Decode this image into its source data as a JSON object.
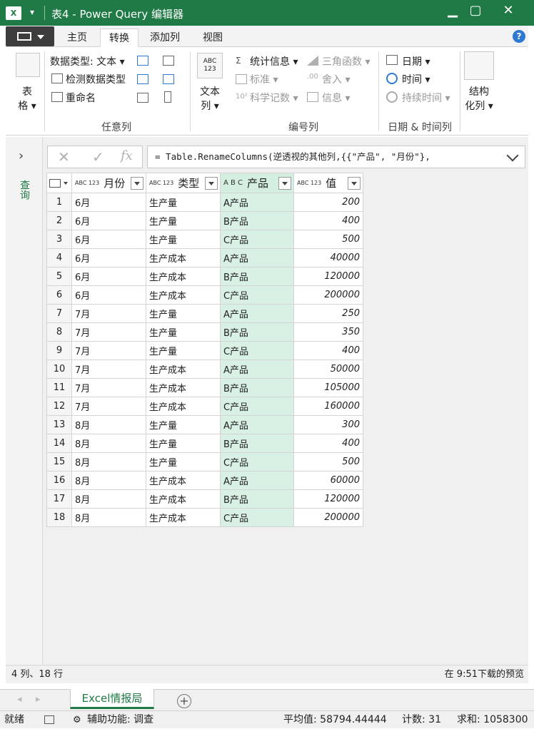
{
  "window": {
    "title": "表4 - Power Query 编辑器",
    "app_badge": "X",
    "quick_access": "▾",
    "minimize": "▁",
    "maximize": "▢",
    "close": "✕"
  },
  "ribbon_tabs": [
    "主页",
    "转换",
    "添加列",
    "视图"
  ],
  "active_tab": "转换",
  "help": "?",
  "ribbon": {
    "table_btn": [
      "表",
      "格 ▾"
    ],
    "datatype": "数据类型: 文本 ▾",
    "detect_type": "检测数据类型",
    "rename": "重命名",
    "group_anycol": "任意列",
    "text_col": [
      "文本",
      "列 ▾"
    ],
    "abc123": [
      "ABC",
      "123"
    ],
    "stats": "统计信息 ▾",
    "standard": "标准 ▾",
    "scientific": "科学记数 ▾",
    "trig": "三角函数 ▾",
    "round": "舍入 ▾",
    "info": "信息 ▾",
    "group_numbercol": "编号列",
    "date": "日期 ▾",
    "time": "时间 ▾",
    "duration": "持续时间 ▾",
    "group_datetime": "日期 & 时间列",
    "structured": [
      "结构",
      "化列 ▾"
    ]
  },
  "side_panel_label": "查询",
  "formula_bar": {
    "cancel": "✕",
    "confirm": "✓",
    "fx": "fx",
    "formula": "= Table.RenameColumns(逆透视的其他列,{{\"产品\", \"月份\"},"
  },
  "table": {
    "columns": [
      {
        "type": "ABC\n123",
        "name": "月份"
      },
      {
        "type": "ABC\n123",
        "name": "类型"
      },
      {
        "type": "A B C",
        "name": "产品"
      },
      {
        "type": "ABC\n123",
        "name": "值"
      }
    ],
    "rows": [
      [
        "1",
        "6月",
        "生产量",
        "A产品",
        "200"
      ],
      [
        "2",
        "6月",
        "生产量",
        "B产品",
        "400"
      ],
      [
        "3",
        "6月",
        "生产量",
        "C产品",
        "500"
      ],
      [
        "4",
        "6月",
        "生产成本",
        "A产品",
        "40000"
      ],
      [
        "5",
        "6月",
        "生产成本",
        "B产品",
        "120000"
      ],
      [
        "6",
        "6月",
        "生产成本",
        "C产品",
        "200000"
      ],
      [
        "7",
        "7月",
        "生产量",
        "A产品",
        "250"
      ],
      [
        "8",
        "7月",
        "生产量",
        "B产品",
        "350"
      ],
      [
        "9",
        "7月",
        "生产量",
        "C产品",
        "400"
      ],
      [
        "10",
        "7月",
        "生产成本",
        "A产品",
        "50000"
      ],
      [
        "11",
        "7月",
        "生产成本",
        "B产品",
        "105000"
      ],
      [
        "12",
        "7月",
        "生产成本",
        "C产品",
        "160000"
      ],
      [
        "13",
        "8月",
        "生产量",
        "A产品",
        "300"
      ],
      [
        "14",
        "8月",
        "生产量",
        "B产品",
        "400"
      ],
      [
        "15",
        "8月",
        "生产量",
        "C产品",
        "500"
      ],
      [
        "16",
        "8月",
        "生产成本",
        "A产品",
        "60000"
      ],
      [
        "17",
        "8月",
        "生产成本",
        "B产品",
        "120000"
      ],
      [
        "18",
        "8月",
        "生产成本",
        "C产品",
        "200000"
      ]
    ]
  },
  "status": {
    "counts": "4 列、18 行",
    "preview": "在 9:51下载的预览"
  },
  "sheet_tab": "Excel情报局",
  "add_sheet": "+",
  "statusbar": {
    "ready": "就绪",
    "accessibility": "辅助功能: 调查",
    "average": "平均值: 58794.44444",
    "count": "计数: 31",
    "sum": "求和: 1058300"
  },
  "colors": {
    "accent": "#1f7a45",
    "selected_column": "#d9f1e4"
  }
}
